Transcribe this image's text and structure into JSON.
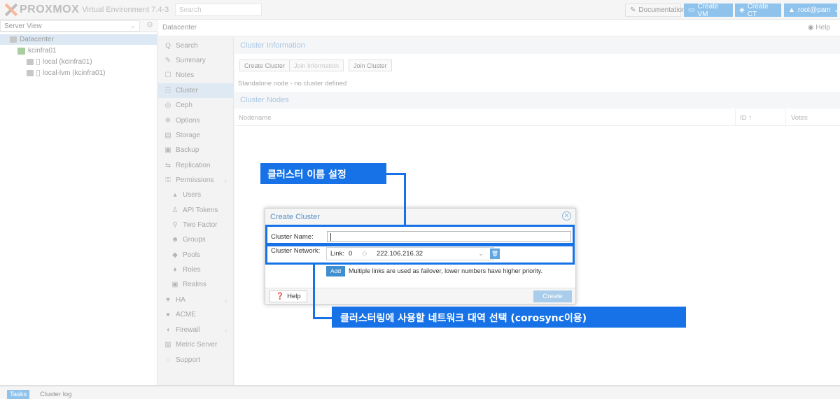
{
  "topbar": {
    "logo": "PROXMOX",
    "product": "Virtual Environment 7.4-3",
    "search_placeholder": "Search",
    "doc_label": "Documentation",
    "create_vm_label": "Create VM",
    "create_ct_label": "Create CT",
    "user_label": "root@pam"
  },
  "tree": {
    "view_label": "Server View",
    "items": [
      {
        "label": "Datacenter"
      },
      {
        "label": "kcinfra01"
      },
      {
        "label": "local (kcinfra01)"
      },
      {
        "label": "local-lvm (kcinfra01)"
      }
    ]
  },
  "breadcrumb": "Datacenter",
  "help_label": "Help",
  "menu": [
    {
      "label": "Search",
      "icon": "Q"
    },
    {
      "label": "Summary",
      "icon": "✎"
    },
    {
      "label": "Notes",
      "icon": "☐"
    },
    {
      "label": "Cluster",
      "icon": "☷"
    },
    {
      "label": "Ceph",
      "icon": "◎"
    },
    {
      "label": "Options",
      "icon": "✲"
    },
    {
      "label": "Storage",
      "icon": "▤"
    },
    {
      "label": "Backup",
      "icon": "▣"
    },
    {
      "label": "Replication",
      "icon": "⇆"
    },
    {
      "label": "Permissions",
      "icon": "⚿"
    },
    {
      "label": "Users",
      "icon": "▴"
    },
    {
      "label": "API Tokens",
      "icon": "♙"
    },
    {
      "label": "Two Factor",
      "icon": "⚲"
    },
    {
      "label": "Groups",
      "icon": "☻"
    },
    {
      "label": "Pools",
      "icon": "◆"
    },
    {
      "label": "Roles",
      "icon": "♦"
    },
    {
      "label": "Realms",
      "icon": "▣"
    },
    {
      "label": "HA",
      "icon": "♥"
    },
    {
      "label": "ACME",
      "icon": "●"
    },
    {
      "label": "Firewall",
      "icon": "◖"
    },
    {
      "label": "Metric Server",
      "icon": "▥"
    },
    {
      "label": "Support",
      "icon": "◌"
    }
  ],
  "content": {
    "cluster_info_title": "Cluster Information",
    "create_cluster_label": "Create Cluster",
    "join_info_label": "Join Information",
    "join_cluster_label": "Join Cluster",
    "standalone_text": "Standalone node - no cluster defined",
    "cluster_nodes_title": "Cluster Nodes",
    "col_nodename": "Nodename",
    "col_id": "ID ↑",
    "col_votes": "Votes"
  },
  "dialog": {
    "title": "Create Cluster",
    "cluster_name_label": "Cluster Name:",
    "cluster_name_value": "",
    "cluster_network_label": "Cluster Network:",
    "link_label": "Link:",
    "link_value": "0",
    "ip_value": "222.106.216.32",
    "add_label": "Add",
    "add_note": "Multiple links are used as failover, lower numbers have higher priority.",
    "help_label": "Help",
    "create_label": "Create"
  },
  "annotations": {
    "callout_top": "클러스터 이름 설정",
    "callout_bottom": "클러스터링에 사용할 네트워크 대역 선택 (corosync이용)",
    "color": "#1672e6"
  },
  "bottom": {
    "tasks_label": "Tasks",
    "cluster_log_label": "Cluster log"
  }
}
